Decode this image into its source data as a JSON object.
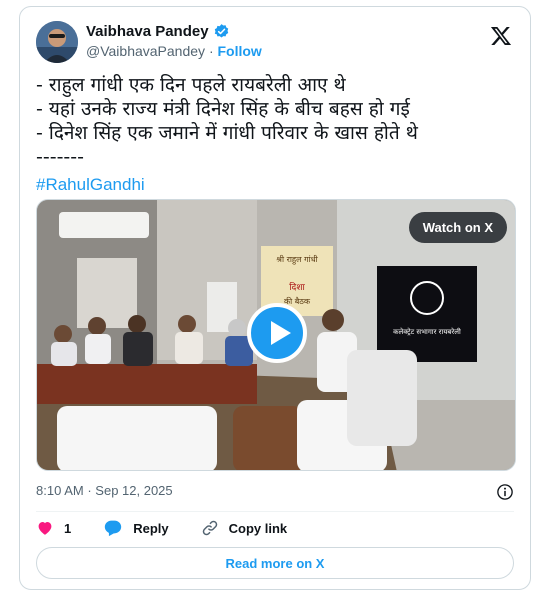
{
  "author": {
    "display_name": "Vaibhava Pandey",
    "handle": "@VaibhavaPandey",
    "separator": "·",
    "follow_label": "Follow"
  },
  "tweet": {
    "lines": [
      "- राहुल गांधी एक दिन पहले रायबरेली आए थे",
      "- यहां उनके राज्य मंत्री दिनेश सिंह के बीच बहस हो गई",
      "- दिनेश सिंह एक जमाने में गांधी परिवार के खास होते थे",
      "-------"
    ],
    "hashtag": "#RahulGandhi"
  },
  "media": {
    "watch_label": "Watch on X",
    "poster_lines": [
      "श्री राहुल गांधी",
      "दिशा",
      "की बैठक"
    ],
    "screen_text": "कलेक्ट्रेट सभागार रायबरेली"
  },
  "meta": {
    "time": "8:10 AM",
    "separator": "·",
    "date": "Sep 12, 2025"
  },
  "actions": {
    "like_count": "1",
    "reply_label": "Reply",
    "copy_label": "Copy link"
  },
  "read_more_label": "Read more on X",
  "colors": {
    "accent": "#1d9bf0",
    "like": "#f91880",
    "text": "#0f1419",
    "muted": "#536471"
  }
}
